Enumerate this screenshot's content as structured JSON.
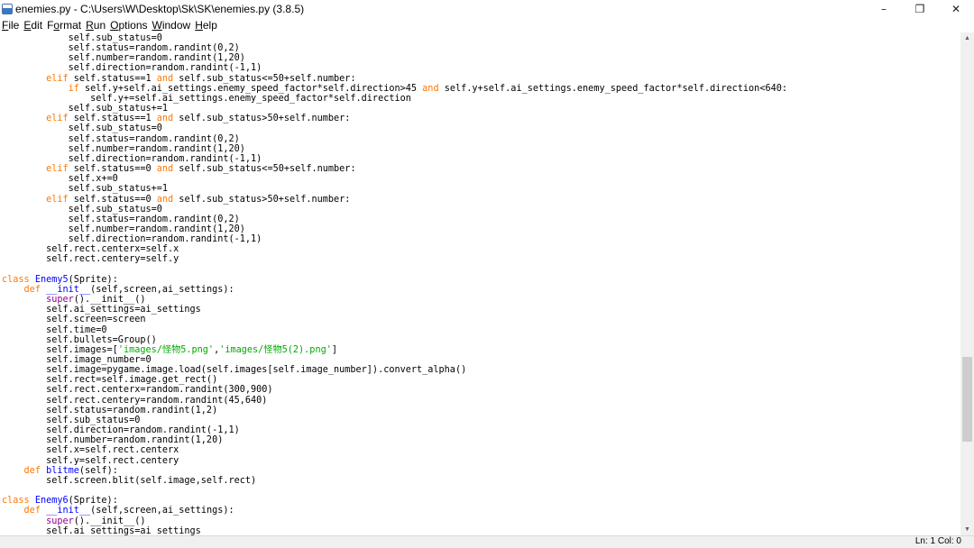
{
  "window": {
    "title": "enemies.py - C:\\Users\\W\\Desktop\\Sk\\SK\\enemies.py (3.8.5)",
    "minimize": "–",
    "maximize": "❐",
    "close": "✕"
  },
  "menu": [
    {
      "u": "F",
      "rest": "ile"
    },
    {
      "u": "E",
      "rest": "dit"
    },
    {
      "u": "",
      "rest": "F",
      "u2": "o",
      "rest2": "rmat"
    },
    {
      "u": "R",
      "rest": "un"
    },
    {
      "u": "O",
      "rest": "ptions"
    },
    {
      "u": "W",
      "rest": "indow"
    },
    {
      "u": "H",
      "rest": "elp"
    }
  ],
  "menu_labels": [
    "File",
    "Edit",
    "Format",
    "Run",
    "Options",
    "Window",
    "Help"
  ],
  "code_lines": [
    "            self.sub_status=0",
    "            self.status=random.randint(0,2)",
    "            self.number=random.randint(1,20)",
    "            self.direction=random.randint(-1,1)",
    "        elif self.status==1 and self.sub_status<=50+self.number:",
    "            if self.y+self.ai_settings.enemy_speed_factor*self.direction>45 and self.y+self.ai_settings.enemy_speed_factor*self.direction<640:",
    "                self.y+=self.ai_settings.enemy_speed_factor*self.direction",
    "            self.sub_status+=1",
    "        elif self.status==1 and self.sub_status>50+self.number:",
    "            self.sub_status=0",
    "            self.status=random.randint(0,2)",
    "            self.number=random.randint(1,20)",
    "            self.direction=random.randint(-1,1)",
    "        elif self.status==0 and self.sub_status<=50+self.number:",
    "            self.x+=0",
    "            self.sub_status+=1",
    "        elif self.status==0 and self.sub_status>50+self.number:",
    "            self.sub_status=0",
    "            self.status=random.randint(0,2)",
    "            self.number=random.randint(1,20)",
    "            self.direction=random.randint(-1,1)",
    "        self.rect.centerx=self.x",
    "        self.rect.centery=self.y",
    "",
    "class Enemy5(Sprite):",
    "    def __init__(self,screen,ai_settings):",
    "        super().__init__()",
    "        self.ai_settings=ai_settings",
    "        self.screen=screen",
    "        self.time=0",
    "        self.bullets=Group()",
    "        self.images=['images/怪物5.png','images/怪物5(2).png']",
    "        self.image_number=0",
    "        self.image=pygame.image.load(self.images[self.image_number]).convert_alpha()",
    "        self.rect=self.image.get_rect()",
    "        self.rect.centerx=random.randint(300,900)",
    "        self.rect.centery=random.randint(45,640)",
    "        self.status=random.randint(1,2)",
    "        self.sub_status=0",
    "        self.direction=random.randint(-1,1)",
    "        self.number=random.randint(1,20)",
    "        self.x=self.rect.centerx",
    "        self.y=self.rect.centery",
    "    def blitme(self):",
    "        self.screen.blit(self.image,self.rect)",
    "",
    "class Enemy6(Sprite):",
    "    def __init__(self,screen,ai_settings):",
    "        super().__init__()",
    "        self.ai_settings=ai_settings"
  ],
  "status": {
    "position": "Ln: 1 Col: 0"
  },
  "colors": {
    "keyword": "#ff7700",
    "builtin": "#900090",
    "string": "#00aa00",
    "definition": "#0000ff"
  }
}
